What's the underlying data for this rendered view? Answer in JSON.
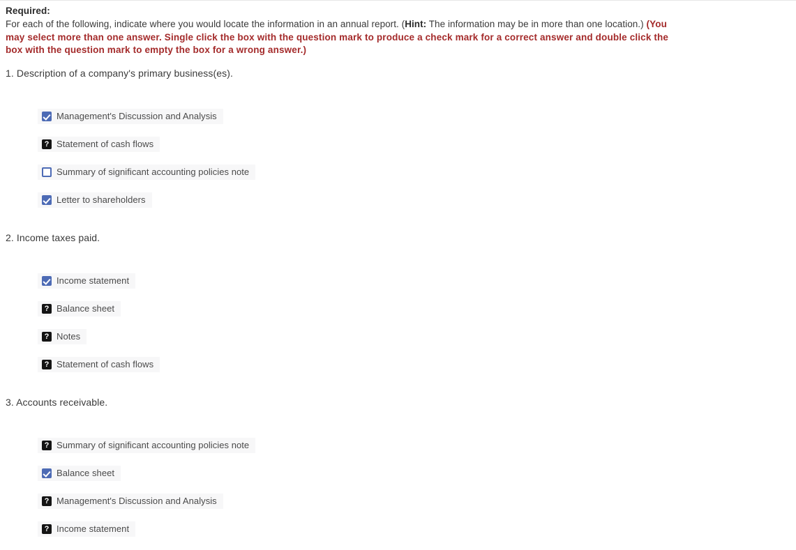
{
  "prompt": {
    "required_label": "Required:",
    "line_part_1": "For each of the following, indicate where you would locate the information in an annual report. (",
    "hint_label": "Hint:",
    "line_part_2": " The information may be in more than one location.) ",
    "red_instruction": "(You may select more than one answer. Single click the box with the question mark to produce a check mark for a correct answer and double click the box with the question mark to empty the box for a wrong answer.)"
  },
  "colors": {
    "checked_box": "#4d6bb5",
    "unknown_box": "#141414",
    "red_text": "#a42b2b",
    "row_background": "#f7f7f8"
  },
  "questions": [
    {
      "number": "1.",
      "text": "1. Description of a company's primary business(es).",
      "options": [
        {
          "label": "Management's Discussion and Analysis",
          "state": "checked"
        },
        {
          "label": "Statement of cash flows",
          "state": "unknown"
        },
        {
          "label": "Summary of significant accounting policies note",
          "state": "empty"
        },
        {
          "label": "Letter to shareholders",
          "state": "checked"
        }
      ]
    },
    {
      "number": "2.",
      "text": "2. Income taxes paid.",
      "options": [
        {
          "label": "Income statement",
          "state": "checked"
        },
        {
          "label": "Balance sheet",
          "state": "unknown"
        },
        {
          "label": "Notes",
          "state": "unknown"
        },
        {
          "label": "Statement of cash flows",
          "state": "unknown"
        }
      ]
    },
    {
      "number": "3.",
      "text": "3. Accounts receivable.",
      "options": [
        {
          "label": "Summary of significant accounting policies note",
          "state": "unknown"
        },
        {
          "label": "Balance sheet",
          "state": "checked"
        },
        {
          "label": "Management's Discussion and Analysis",
          "state": "unknown"
        },
        {
          "label": "Income statement",
          "state": "unknown"
        }
      ]
    }
  ]
}
